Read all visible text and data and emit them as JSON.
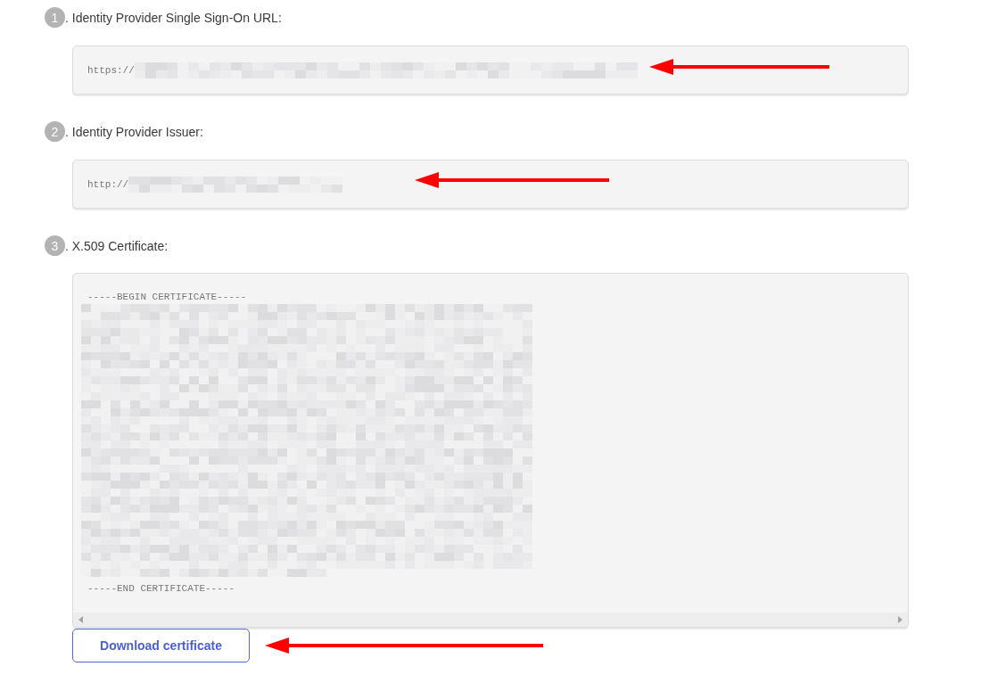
{
  "steps": [
    {
      "number": "1",
      "label": ". Identity Provider Single Sign-On URL:",
      "field": {
        "kind": "single_line",
        "value": "https://",
        "redacted": true,
        "arrow": true
      }
    },
    {
      "number": "2",
      "label": ". Identity Provider Issuer:",
      "field": {
        "kind": "single_line",
        "value": "http://",
        "redacted": true,
        "arrow": true
      }
    },
    {
      "number": "3",
      "label": ". X.509 Certificate:",
      "field": {
        "kind": "certificate",
        "begin_line": "-----BEGIN CERTIFICATE-----",
        "end_line": "-----END CERTIFICATE-----",
        "redacted": true
      }
    }
  ],
  "download_button": {
    "label": "Download certificate",
    "arrow": true
  }
}
